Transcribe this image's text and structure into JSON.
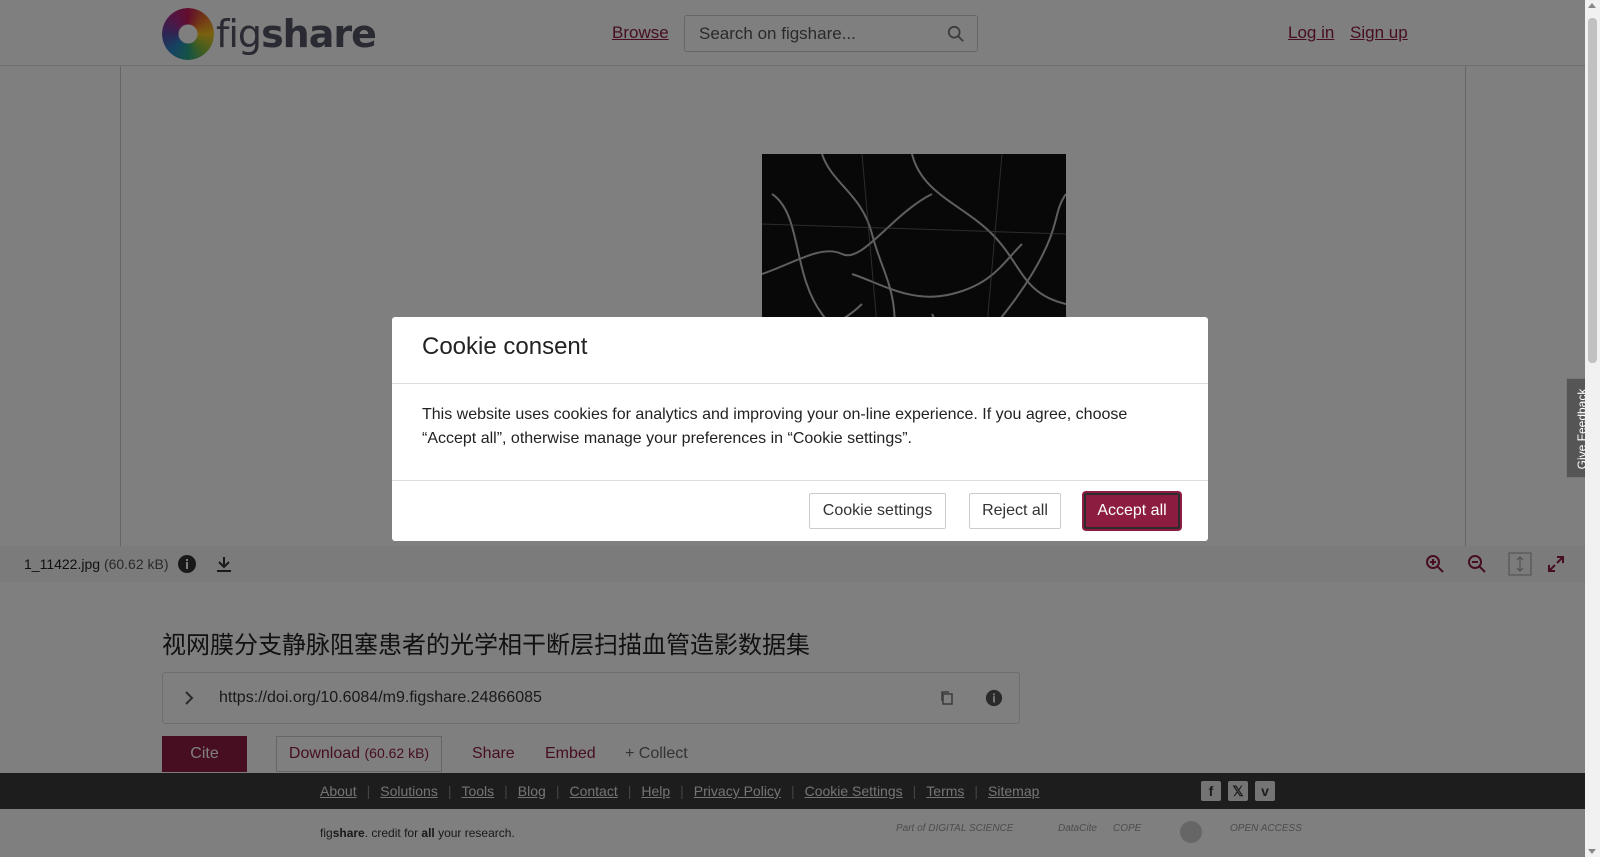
{
  "header": {
    "logo_prefix": "fig",
    "logo_suffix": "share",
    "browse": "Browse",
    "search_placeholder": "Search on figshare...",
    "login": "Log in",
    "signup": "Sign up"
  },
  "viewer": {
    "filename": "1_11422.jpg",
    "filesize": "(60.62 kB)"
  },
  "item": {
    "title": "视网膜分支静脉阻塞患者的光学相干断层扫描血管造影数据集",
    "doi": "https://doi.org/10.6084/m9.figshare.24866085",
    "cite": "Cite",
    "download": "Download",
    "download_size": "(60.62 kB)",
    "share": "Share",
    "embed": "Embed",
    "collect": "+ Collect"
  },
  "footer": {
    "links": [
      "About",
      "Solutions",
      "Tools",
      "Blog",
      "Contact",
      "Help",
      "Privacy Policy",
      "Cookie Settings",
      "Terms",
      "Sitemap"
    ],
    "tagline_prefix": "fig",
    "tagline_bold": "share",
    "tagline_mid": ". credit for ",
    "tagline_all": "all",
    "tagline_end": " your research.",
    "partners": [
      "Part of DIGITAL SCIENCE",
      "DataCite",
      "COPE",
      "",
      "OPEN ACCESS"
    ]
  },
  "cookie_modal": {
    "title": "Cookie consent",
    "body": "This website uses cookies for analytics and improving your on-line experience. If you agree, choose “Accept all”, otherwise manage your preferences in “Cookie settings”.",
    "settings_btn": "Cookie settings",
    "reject_btn": "Reject all",
    "accept_btn": "Accept all"
  },
  "feedback": "Give Feedback",
  "colors": {
    "brand": "#8c1d40",
    "footer_bg": "#3a3a3a"
  }
}
